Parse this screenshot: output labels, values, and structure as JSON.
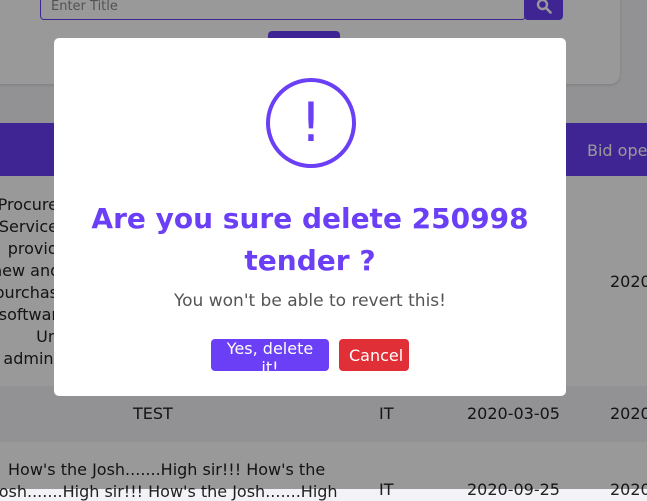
{
  "search": {
    "title_placeholder": "Enter Title"
  },
  "table": {
    "header_bid_opening": "Bid oper",
    "rows": [
      {
        "description_lines": [
          "Procure",
          "Service",
          "provid",
          "new and",
          "purchas",
          "softwar",
          "Un",
          "admini"
        ],
        "bid_opening": "2020"
      },
      {
        "title": "TEST",
        "department": "IT",
        "date": "2020-03-05",
        "bid_opening": "2020"
      },
      {
        "title_line1": "How's the Josh.......High sir!!! How's the",
        "title_line2": "Josh.......High sir!!! How's the Josh.......High",
        "department": "IT",
        "date": "2020-09-25",
        "bid_opening": "2020"
      }
    ]
  },
  "modal": {
    "icon_glyph": "!",
    "title": "Are you sure delete 250998 tender ?",
    "text": "You won't be able to revert this!",
    "confirm_label": "Yes, delete it!",
    "cancel_label": "Cancel"
  },
  "colors": {
    "accent": "#6a3ff5",
    "danger": "#e02f36"
  }
}
